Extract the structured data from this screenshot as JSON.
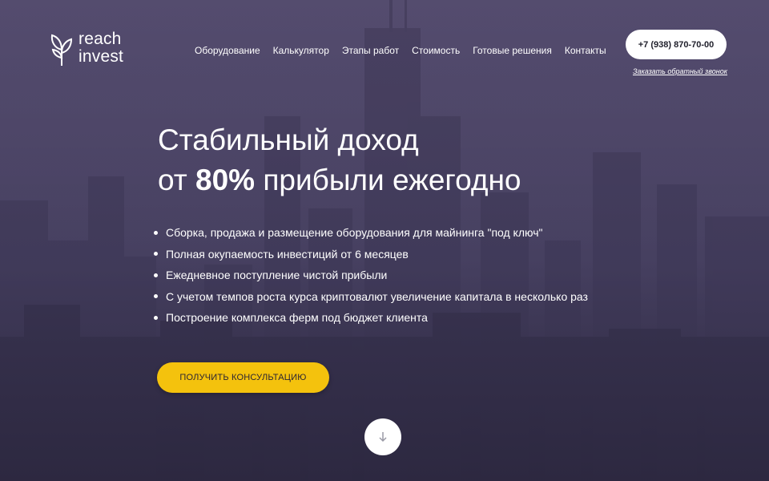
{
  "brand": {
    "line1": "reach",
    "line2": "invest"
  },
  "nav": {
    "items": [
      {
        "label": "Оборудование"
      },
      {
        "label": "Калькулятор"
      },
      {
        "label": "Этапы работ"
      },
      {
        "label": "Стоимость"
      },
      {
        "label": "Готовые решения"
      },
      {
        "label": "Контакты"
      }
    ]
  },
  "header": {
    "phone": "+7 (938) 870-70-00",
    "callback_link": "Заказать обратный звонок"
  },
  "hero": {
    "title_line1": "Стабильный доход",
    "title_line2_prefix": "от ",
    "title_line2_highlight": "80%",
    "title_line2_suffix": " прибыли ежегодно",
    "bullets": [
      "Сборка, продажа и размещение оборудования для майнинга \"под ключ\"",
      "Полная окупаемость инвестиций от 6 месяцев",
      "Ежедневное поступление чистой прибыли",
      "С учетом темпов роста курса криптовалют увеличение капитала в несколько раз",
      "Построение комплекса ферм под бюджет клиента"
    ],
    "cta_label": "ПОЛУЧИТЬ КОНСУЛЬТАЦИЮ"
  },
  "icons": {
    "logo": "sprout-logo-icon",
    "scroll": "arrow-down-icon"
  },
  "colors": {
    "accent": "#f4c20d",
    "overlay": "#3c3850",
    "text": "#ffffff"
  }
}
